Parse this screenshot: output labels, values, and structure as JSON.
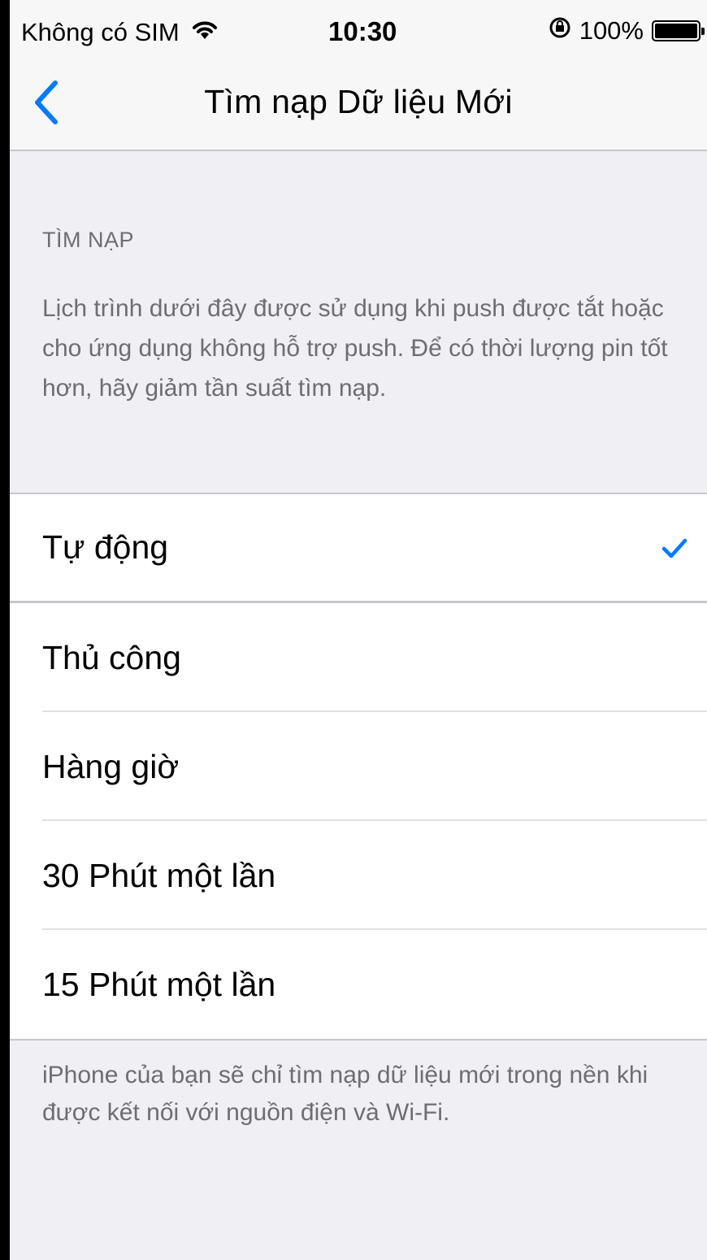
{
  "status_bar": {
    "carrier": "Không có SIM",
    "time": "10:30",
    "battery_percent": "100%",
    "battery_level": 1.0,
    "wifi_icon": "wifi-icon",
    "orientation_lock_icon": "orientation-lock-icon"
  },
  "nav": {
    "title": "Tìm nạp Dữ liệu Mới",
    "back_icon": "chevron-left-icon"
  },
  "section": {
    "header": "TÌM NẠP",
    "description": "Lịch trình dưới đây được sử dụng khi push được tắt hoặc cho ứng dụng không hỗ trợ push. Để có thời lượng pin tốt hơn, hãy giảm tần suất tìm nạp."
  },
  "options": [
    {
      "label": "Tự động",
      "selected": true
    },
    {
      "label": "Thủ công",
      "selected": false
    },
    {
      "label": "Hàng giờ",
      "selected": false
    },
    {
      "label": "30 Phút một lần",
      "selected": false
    },
    {
      "label": "15 Phút một lần",
      "selected": false
    }
  ],
  "footer": {
    "note": "iPhone của bạn sẽ chỉ tìm nạp dữ liệu mới trong nền khi được kết nối với nguồn điện và Wi-Fi."
  },
  "colors": {
    "accent": "#007aff",
    "background": "#efeff4",
    "secondary_text": "#6d6d72"
  }
}
